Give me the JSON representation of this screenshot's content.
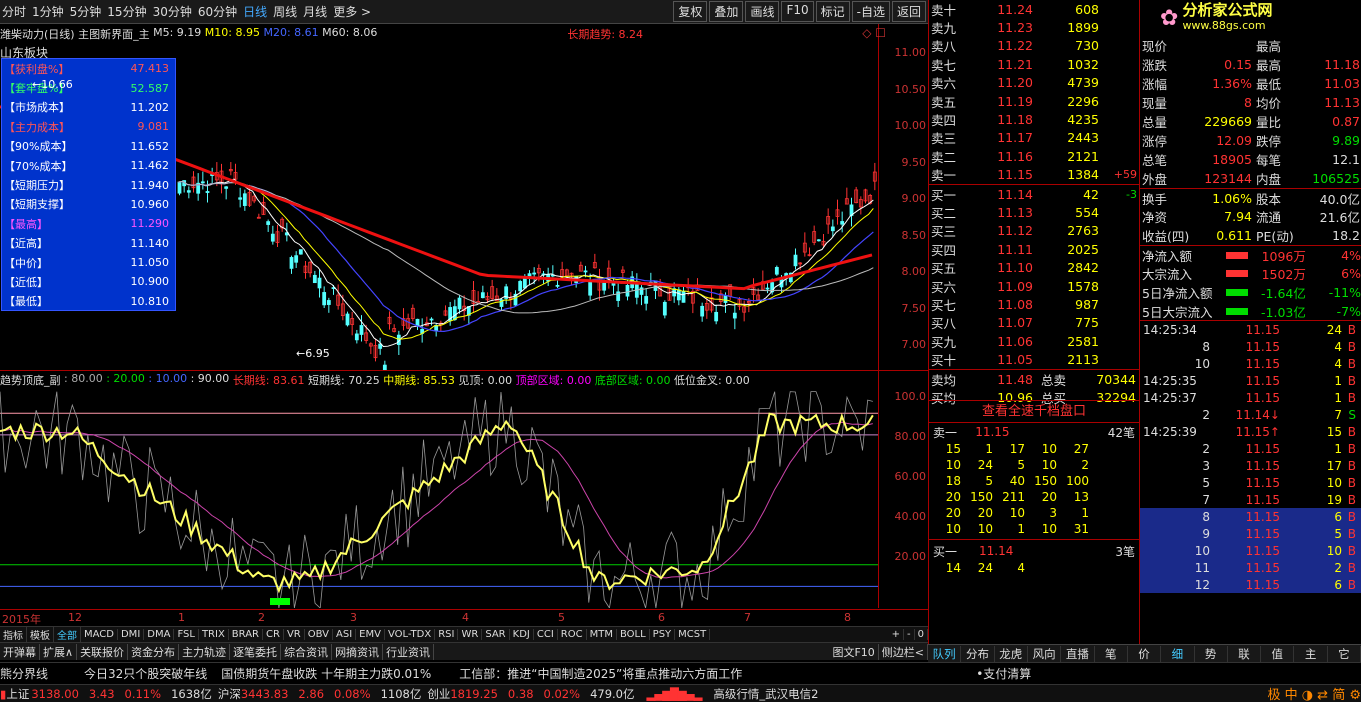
{
  "toolbar": {
    "periods": [
      "分时",
      "1分钟",
      "5分钟",
      "15分钟",
      "30分钟",
      "60分钟",
      "日线",
      "周线",
      "月线",
      "更多 >"
    ],
    "active": "日线",
    "tools": [
      "复权",
      "叠加",
      "画线",
      "F10",
      "标记",
      "-自选",
      "返回"
    ]
  },
  "legend_main": {
    "title": "潍柴动力(日线) 主图新界面_主",
    "ma5": "M5: 9.19",
    "ma10": "M10: 8.95",
    "ma20": "M20: 8.61",
    "ma60": "M60: 8.06",
    "long_trend": "长期趋势: 8.24",
    "sector": "山东板块",
    "high_mark": "10.66",
    "low_mark": "6.95"
  },
  "chip": [
    {
      "label": "【获利盘%】",
      "value": "47.413",
      "lc": "#ff5555",
      "vc": "#ff5555"
    },
    {
      "label": "【套牢盘%】",
      "value": "52.587",
      "lc": "#33ff66",
      "vc": "#33ff66"
    },
    {
      "label": "【市场成本】",
      "value": "11.202",
      "lc": "#fff",
      "vc": "#fff"
    },
    {
      "label": "【主力成本】",
      "value": "9.081",
      "lc": "#ff5555",
      "vc": "#ff5555"
    },
    {
      "label": "【90%成本】",
      "value": "11.652",
      "lc": "#fff",
      "vc": "#fff"
    },
    {
      "label": "【70%成本】",
      "value": "11.462",
      "lc": "#fff",
      "vc": "#fff"
    },
    {
      "label": "【短期压力】",
      "value": "11.940",
      "lc": "#fff",
      "vc": "#fff"
    },
    {
      "label": "【短期支撑】",
      "value": "10.960",
      "lc": "#fff",
      "vc": "#fff"
    },
    {
      "label": "【最高】",
      "value": "11.290",
      "lc": "#ff55ff",
      "vc": "#ff55ff"
    },
    {
      "label": "【近高】",
      "value": "11.140",
      "lc": "#fff",
      "vc": "#fff"
    },
    {
      "label": "【中价】",
      "value": "11.050",
      "lc": "#fff",
      "vc": "#fff"
    },
    {
      "label": "【近低】",
      "value": "10.900",
      "lc": "#fff",
      "vc": "#fff"
    },
    {
      "label": "【最低】",
      "value": "10.810",
      "lc": "#fff",
      "vc": "#fff"
    }
  ],
  "axis_main": [
    "11.00",
    "10.50",
    "10.00",
    "9.50",
    "9.00",
    "8.50",
    "8.00",
    "7.50",
    "7.00"
  ],
  "axis_ind": [
    "100.0",
    "80.00",
    "60.00",
    "40.00",
    "20.00"
  ],
  "axis_bottom": "日线",
  "legend_ind": {
    "title": "趋势顶底_副",
    "v1": ": 80.00",
    "v2": ": 20.00",
    "v3": ": 10.00",
    "v4": ": 90.00",
    "long": "长期线: 83.61",
    "short": "短期线: 70.25",
    "mid": "中期线: 85.53",
    "see_top": "见顶: 0.00",
    "top_zone": "顶部区域: 0.00",
    "bottom_zone": "底部区域: 0.00",
    "low_cross": "低位金叉: 0.00"
  },
  "dates": [
    "2015年",
    "12",
    "1",
    "2",
    "3",
    "4",
    "5",
    "6",
    "7",
    "8"
  ],
  "indicator_tabs": [
    "指标",
    "模板",
    "全部",
    "MACD",
    "DMI",
    "DMA",
    "FSL",
    "TRIX",
    "BRAR",
    "CR",
    "VR",
    "OBV",
    "ASI",
    "EMV",
    "VOL-TDX",
    "RSI",
    "WR",
    "SAR",
    "KDJ",
    "CCI",
    "ROC",
    "MTM",
    "BOLL",
    "PSY",
    "MCST"
  ],
  "func_tabs": [
    "开弹幕",
    "扩展∧",
    "关联报价",
    "资金分布",
    "主力轨迹",
    "逐笔委托",
    "综合资讯",
    "网摘资讯",
    "行业资讯"
  ],
  "chart_opts": [
    "图文F10",
    "侧边栏<"
  ],
  "chart_ctrl": [
    "+",
    "-",
    "0"
  ],
  "news": [
    "熊分界线",
    "今日32只个股突破年线",
    "国债期货午盘收跌 十年期主力跌0.01%",
    "工信部：推进“中国制造2025”将重点推动六方面工作",
    "•支付清算"
  ],
  "status": {
    "sh_name": "上证",
    "sh_val": "3138.00",
    "sh_chg": "3.43",
    "sh_pct": "0.11%",
    "sh_amt": "1638亿",
    "hs_name": "沪深",
    "hs_val": "3443.83",
    "hs_chg": "2.86",
    "hs_pct": "0.08%",
    "hs_amt": "1108亿",
    "cy_name": "创业",
    "cy_val": "1819.25",
    "cy_chg": "0.38",
    "cy_pct": "0.02%",
    "cy_amt": "479.0亿",
    "server": "高级行情_武汉电信2"
  },
  "sell": [
    {
      "l": "卖十",
      "p": "11.24",
      "v": "608",
      "c": ""
    },
    {
      "l": "卖九",
      "p": "11.23",
      "v": "1899",
      "c": ""
    },
    {
      "l": "卖八",
      "p": "11.22",
      "v": "730",
      "c": ""
    },
    {
      "l": "卖七",
      "p": "11.21",
      "v": "1032",
      "c": ""
    },
    {
      "l": "卖六",
      "p": "11.20",
      "v": "4739",
      "c": ""
    },
    {
      "l": "卖五",
      "p": "11.19",
      "v": "2296",
      "c": ""
    },
    {
      "l": "卖四",
      "p": "11.18",
      "v": "4235",
      "c": ""
    },
    {
      "l": "卖三",
      "p": "11.17",
      "v": "2443",
      "c": ""
    },
    {
      "l": "卖二",
      "p": "11.16",
      "v": "2121",
      "c": ""
    },
    {
      "l": "卖一",
      "p": "11.15",
      "v": "1384",
      "c": "+59"
    }
  ],
  "buy": [
    {
      "l": "买一",
      "p": "11.14",
      "v": "42",
      "c": "-3"
    },
    {
      "l": "买二",
      "p": "11.13",
      "v": "554",
      "c": ""
    },
    {
      "l": "买三",
      "p": "11.12",
      "v": "2763",
      "c": ""
    },
    {
      "l": "买四",
      "p": "11.11",
      "v": "2025",
      "c": ""
    },
    {
      "l": "买五",
      "p": "11.10",
      "v": "2842",
      "c": ""
    },
    {
      "l": "买六",
      "p": "11.09",
      "v": "1578",
      "c": ""
    },
    {
      "l": "买七",
      "p": "11.08",
      "v": "987",
      "c": ""
    },
    {
      "l": "买八",
      "p": "11.07",
      "v": "775",
      "c": ""
    },
    {
      "l": "买九",
      "p": "11.06",
      "v": "2581",
      "c": ""
    },
    {
      "l": "买十",
      "p": "11.05",
      "v": "2113",
      "c": ""
    }
  ],
  "avg": {
    "sell_l": "卖均",
    "sell_p": "11.48",
    "sell_tl": "总卖",
    "sell_tv": "70344",
    "buy_l": "买均",
    "buy_p": "10.96",
    "buy_tl": "总买",
    "buy_tv": "32294"
  },
  "deep": {
    "title": "查看全速千档盘口",
    "sell1": "卖一",
    "sell1p": "11.15",
    "sell1n": "42笔",
    "sell_rows": [
      [
        "15",
        "1",
        "17",
        "10",
        "27"
      ],
      [
        "10",
        "24",
        "5",
        "10",
        "2"
      ],
      [
        "18",
        "5",
        "40",
        "150",
        "100"
      ],
      [
        "20",
        "150",
        "211",
        "20",
        "13"
      ],
      [
        "20",
        "20",
        "10",
        "3",
        "1"
      ],
      [
        "10",
        "10",
        "1",
        "10",
        "31"
      ]
    ],
    "buy1": "买一",
    "buy1p": "11.14",
    "buy1n": "3笔",
    "buy_rows": [
      [
        "14",
        "24",
        "4",
        "",
        ""
      ]
    ]
  },
  "logo": {
    "name": "分析家公式网",
    "url": "www.88gs.com"
  },
  "stats": [
    [
      "现价",
      "",
      "最高",
      ""
    ],
    [
      "涨跌",
      "0.15",
      "最高",
      "11.18"
    ],
    [
      "涨幅",
      "1.36%",
      "最低",
      "11.03"
    ],
    [
      "现量",
      "8",
      "均价",
      "11.13"
    ],
    [
      "总量",
      "229669",
      "量比",
      "0.87"
    ],
    [
      "涨停",
      "12.09",
      "跌停",
      "9.89"
    ],
    [
      "总笔",
      "18905",
      "每笔",
      "12.1"
    ],
    [
      "外盘",
      "123144",
      "内盘",
      "106525"
    ],
    [
      "换手",
      "1.06%",
      "股本",
      "40.0亿"
    ],
    [
      "净资",
      "7.94",
      "流通",
      "21.6亿"
    ],
    [
      "收益(四)",
      "0.611",
      "PE(动)",
      "18.2"
    ],
    [
      "净流入额",
      "",
      "1096万",
      "4%"
    ],
    [
      "大宗流入",
      "",
      "1502万",
      "6%"
    ],
    [
      "5日净流入额",
      "",
      "-1.64亿",
      "-11%"
    ],
    [
      "5日大宗流入",
      "",
      "-1.03亿",
      "-7%"
    ]
  ],
  "ticks": [
    [
      "14:25:34",
      "11.15",
      "24",
      "B"
    ],
    [
      "8",
      "11.15",
      "4",
      "B"
    ],
    [
      "10",
      "11.15",
      "4",
      "B"
    ],
    [
      "14:25:35",
      "11.15",
      "1",
      "B"
    ],
    [
      "14:25:37",
      "11.15",
      "1",
      "B"
    ],
    [
      "2",
      "11.14↓",
      "7",
      "S"
    ],
    [
      "14:25:39",
      "11.15↑",
      "15",
      "B"
    ],
    [
      "2",
      "11.15",
      "1",
      "B"
    ],
    [
      "3",
      "11.15",
      "17",
      "B"
    ],
    [
      "5",
      "11.15",
      "10",
      "B"
    ],
    [
      "7",
      "11.15",
      "19",
      "B"
    ],
    [
      "8",
      "11.15",
      "6",
      "B"
    ],
    [
      "9",
      "11.15",
      "5",
      "B"
    ],
    [
      "10",
      "11.15",
      "10",
      "B"
    ],
    [
      "11",
      "11.15",
      "2",
      "B"
    ],
    [
      "12",
      "11.15",
      "6",
      "B"
    ]
  ],
  "right_tabs": [
    "队列",
    "分布",
    "龙虎",
    "风向",
    "直播",
    "笔",
    "价",
    "细",
    "势",
    "联",
    "值",
    "主",
    "它"
  ],
  "chart_data": {
    "type": "candlestick",
    "ylim": [
      6.8,
      11.4
    ],
    "ind_ylim": [
      0,
      110
    ]
  }
}
